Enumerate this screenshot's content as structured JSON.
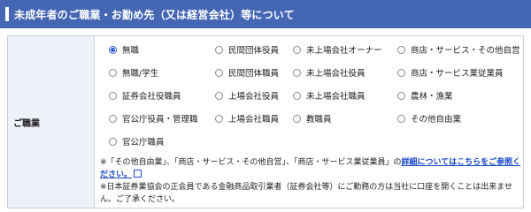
{
  "header": {
    "title": "未成年者のご職業・お勤め先（又は経営会社）等について"
  },
  "form": {
    "label": "ご職業",
    "options": [
      {
        "label": "無職",
        "checked": true
      },
      {
        "label": "民間団体役員",
        "checked": false
      },
      {
        "label": "未上場会社オーナー",
        "checked": false
      },
      {
        "label": "商店・サービス・その他自営",
        "checked": false
      },
      {
        "label": "無職/学生",
        "checked": false
      },
      {
        "label": "民間団体職員",
        "checked": false
      },
      {
        "label": "未上場会社役員",
        "checked": false
      },
      {
        "label": "商店・サービス業従業員",
        "checked": false
      },
      {
        "label": "証券会社役職員",
        "checked": false
      },
      {
        "label": "上場会社役員",
        "checked": false
      },
      {
        "label": "未上場会社職員",
        "checked": false
      },
      {
        "label": "農林・漁業",
        "checked": false
      },
      {
        "label": "官公庁役員・管理職",
        "checked": false
      },
      {
        "label": "上場会社職員",
        "checked": false
      },
      {
        "label": "教職員",
        "checked": false
      },
      {
        "label": "その他自由業",
        "checked": false
      },
      {
        "label": "官公庁職員",
        "checked": false
      }
    ],
    "note1_prefix": "※「その他自由業」、「商店・サービス・その他自営」、「商店・サービス業従業員」の",
    "note1_link": "詳細についてはこちらをご参照ください。",
    "note2": "※日本証券業協会の正会員である金融商品取引業者（証券会社等）にご勤務の方は当社に口座を開くことは出来ません。ご了承ください。",
    "icons": {
      "radio": "radio-icon",
      "external": "external-link-icon"
    }
  }
}
